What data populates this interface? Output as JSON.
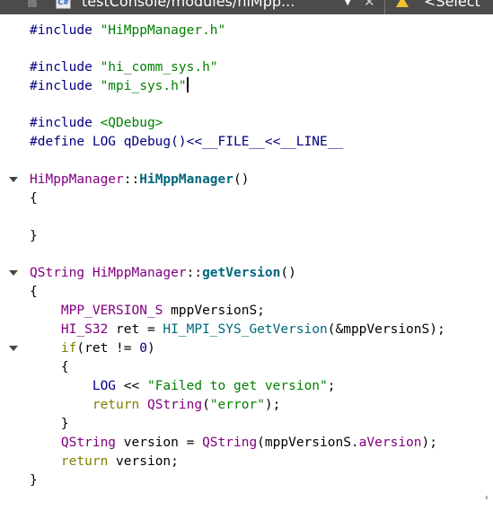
{
  "tabbar": {
    "file_badge": "C#",
    "path": "testConsole/modules/hiMpp...",
    "select_label": "<Select"
  },
  "lines": {
    "l1": {
      "t1": "#include ",
      "t2": "\"HiMppManager.h\""
    },
    "l2": {
      "t1": "#include ",
      "t2": "\"hi_comm_sys.h\""
    },
    "l3": {
      "t1": "#include ",
      "t2": "\"mpi_sys.h\""
    },
    "l4": {
      "t1": "#include ",
      "t2": "<QDebug>"
    },
    "l5": {
      "t1": "#define LOG qDebug()<<__FILE__<<__LINE__"
    },
    "l6": {
      "t1": "HiMppManager",
      "t2": "::",
      "t3": "HiMppManager",
      "t4": "()"
    },
    "l7": {
      "t1": "{"
    },
    "l8": {
      "t1": "}"
    },
    "l9": {
      "t1": "QString",
      "t2": " ",
      "t3": "HiMppManager",
      "t4": "::",
      "t5": "getVersion",
      "t6": "()"
    },
    "l10": {
      "t1": "{"
    },
    "l11": {
      "t1": "    ",
      "t2": "MPP_VERSION_S",
      "t3": " mppVersionS;"
    },
    "l12": {
      "t1": "    ",
      "t2": "HI_S32",
      "t3": " ret = ",
      "t4": "HI_MPI_SYS_GetVersion",
      "t5": "(&mppVersionS);"
    },
    "l13": {
      "t1": "    ",
      "t2": "if",
      "t3": "(ret != ",
      "t4": "0",
      "t5": ")"
    },
    "l14": {
      "t1": "    {"
    },
    "l15": {
      "t1": "        ",
      "t2": "LOG",
      "t3": " << ",
      "t4": "\"Failed to get version\"",
      "t5": ";"
    },
    "l16": {
      "t1": "        ",
      "t2": "return",
      "t3": " ",
      "t4": "QString",
      "t5": "(",
      "t6": "\"error\"",
      "t7": ");"
    },
    "l17": {
      "t1": "    }"
    },
    "l18": {
      "t1": "    ",
      "t2": "QString",
      "t3": " version = ",
      "t4": "QString",
      "t5": "(mppVersionS.",
      "t6": "aVersion",
      "t7": ");"
    },
    "l19": {
      "t1": "    ",
      "t2": "return",
      "t3": " version;"
    },
    "l20": {
      "t1": "}"
    }
  },
  "corner_glyph": "‹"
}
